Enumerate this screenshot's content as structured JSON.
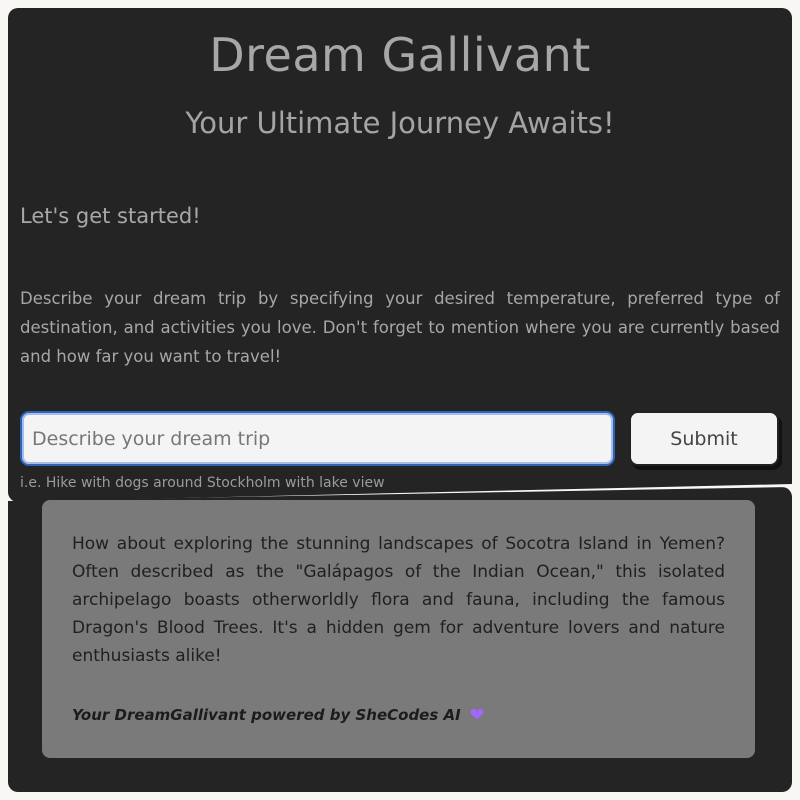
{
  "header": {
    "title": "Dream Gallivant",
    "subtitle": "Your Ultimate Journey Awaits!"
  },
  "intro": {
    "started": "Let's get started!",
    "description": "Describe your dream trip by specifying your desired temperature, preferred type of destination, and activities you love. Don't forget to mention where you are currently based and how far you want to travel!"
  },
  "form": {
    "input_value": "",
    "input_placeholder": "Describe your dream trip",
    "submit_label": "Submit",
    "hint": "i.e. Hike with dogs around Stockholm with lake view"
  },
  "result": {
    "text": "How about exploring the stunning landscapes of Socotra Island in Yemen? Often described as the \"Galápagos of the Indian Ocean,\" this isolated archipelago boasts otherworldly flora and fauna, including the famous Dragon's Blood Trees. It's a hidden gem for adventure lovers and nature enthusiasts alike!",
    "powered_by": "Your DreamGallivant powered by SheCodes AI",
    "powered_icon": "purple-heart-icon",
    "powered_icon_color": "#a366ff"
  },
  "colors": {
    "panel": "#242424",
    "card": "#7a7a7a",
    "input_border": "#2f63b8",
    "text_light": "#a7a7a7"
  }
}
